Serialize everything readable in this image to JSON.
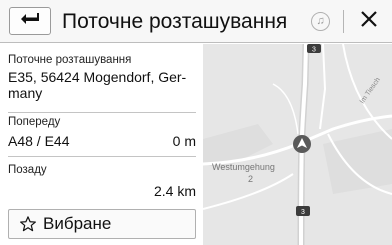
{
  "header": {
    "title": "Поточне розташування"
  },
  "info": {
    "current_label": "Поточне розташування",
    "current_address_line1": "E35, 56424 Mogendorf, Ger-",
    "current_address_line2": "many",
    "ahead_label": "Попереду",
    "ahead_road": "A48 / E44",
    "ahead_distance": "0 m",
    "behind_label": "Позаду",
    "behind_distance": "2.4 km"
  },
  "favorites": {
    "label": "Вибране"
  },
  "map": {
    "road_label": "Westumgehung",
    "road_label_number": "2",
    "street_label": "Im Tiesch",
    "road_shield": "3"
  }
}
